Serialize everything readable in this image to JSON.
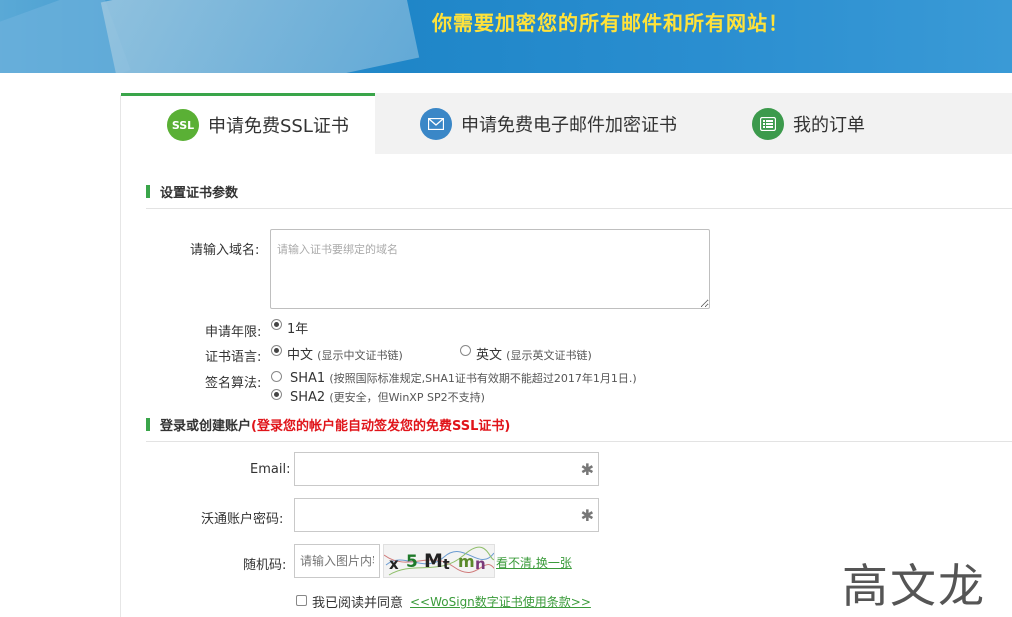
{
  "banner": {
    "slogan": "你需要加密您的所有邮件和所有网站！"
  },
  "tabs": [
    {
      "icon": "ssl-icon",
      "icon_text": "SSL",
      "label": "申请免费SSL证书"
    },
    {
      "icon": "envelope-icon",
      "label": "申请免费电子邮件加密证书"
    },
    {
      "icon": "list-icon",
      "label": "我的订单"
    }
  ],
  "section1": {
    "title": "设置证书参数"
  },
  "domain": {
    "label": "请输入域名:",
    "placeholder": "请输入证书要绑定的域名"
  },
  "period": {
    "label": "申请年限:",
    "option": "1年"
  },
  "language": {
    "label": "证书语言:",
    "options": [
      {
        "text": "中文",
        "note": "(显示中文证书链)"
      },
      {
        "text": "英文",
        "note": "(显示英文证书链)"
      }
    ]
  },
  "algorithm": {
    "label": "签名算法:",
    "options": [
      {
        "text": "SHA1",
        "note": "(按照国际标准规定,SHA1证书有效期不能超过2017年1月1日.)"
      },
      {
        "text": "SHA2",
        "note": "(更安全，但WinXP SP2不支持)"
      }
    ]
  },
  "section2": {
    "title": "登录或创建账户",
    "highlight": "(登录您的帐户能自动签发您的免费SSL证书)"
  },
  "email": {
    "label": "Email:",
    "required": "✱"
  },
  "password": {
    "label": "沃通账户密码:",
    "required": "✱"
  },
  "captcha": {
    "label": "随机码:",
    "placeholder": "请输入图片内容",
    "image_text": [
      "x",
      "5",
      "M",
      "t",
      "m",
      "n"
    ],
    "refresh_link": "看不清,换一张"
  },
  "agreement": {
    "text": "我已阅读并同意",
    "link": "<<WoSign数字证书使用条款>>"
  },
  "watermark": "高文龙",
  "colors": {
    "accent": "#3aa54a",
    "banner": "#2f8fcb",
    "slogan": "#ffe23a",
    "warning": "#e0141a"
  }
}
